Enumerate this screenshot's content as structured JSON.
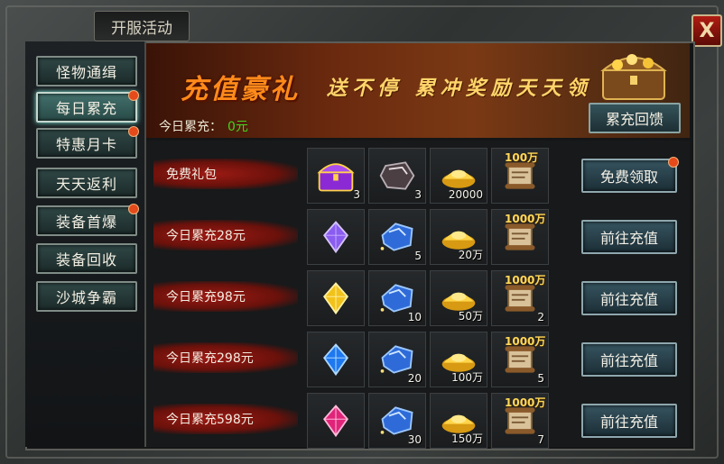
{
  "window": {
    "title": "开服活动",
    "close_label": "X"
  },
  "sidebar": {
    "items": [
      {
        "label": "怪物通缉",
        "active": false,
        "dot": false
      },
      {
        "label": "每日累充",
        "active": true,
        "dot": true
      },
      {
        "label": "特惠月卡",
        "active": false,
        "dot": true
      },
      {
        "label": "天天返利",
        "active": false,
        "dot": false
      },
      {
        "label": "装备首爆",
        "active": false,
        "dot": true
      },
      {
        "label": "装备回收",
        "active": false,
        "dot": false
      },
      {
        "label": "沙城争霸",
        "active": false,
        "dot": false
      }
    ]
  },
  "banner": {
    "title": "充值豪礼",
    "subtitle": "送不停 累冲奖励天天领",
    "today_label": "今日累充：",
    "today_value": "0元",
    "recharge_button": "累充回馈"
  },
  "rows": [
    {
      "label": "免费礼包",
      "button": "免费领取",
      "button_dot": true,
      "items": [
        {
          "icon": "purple-chest-icon",
          "qty": "3",
          "tag": ""
        },
        {
          "icon": "dark-stone-icon",
          "qty": "3",
          "tag": ""
        },
        {
          "icon": "gold-ingot-icon",
          "qty": "20000",
          "tag": ""
        },
        {
          "icon": "scroll-icon",
          "qty": "",
          "tag": "100万"
        }
      ]
    },
    {
      "label": "今日累充28元",
      "button": "前往充值",
      "button_dot": false,
      "items": [
        {
          "icon": "purple-gem-icon",
          "qty": "",
          "tag": ""
        },
        {
          "icon": "blue-crystal-icon",
          "qty": "5",
          "tag": ""
        },
        {
          "icon": "gold-ingot-icon",
          "qty": "20万",
          "tag": ""
        },
        {
          "icon": "scroll-icon",
          "qty": "",
          "tag": "1000万"
        }
      ]
    },
    {
      "label": "今日累充98元",
      "button": "前往充值",
      "button_dot": false,
      "items": [
        {
          "icon": "yellow-gem-icon",
          "qty": "",
          "tag": ""
        },
        {
          "icon": "blue-crystal-icon",
          "qty": "10",
          "tag": ""
        },
        {
          "icon": "gold-ingot-icon",
          "qty": "50万",
          "tag": ""
        },
        {
          "icon": "scroll-icon",
          "qty": "2",
          "tag": "1000万"
        }
      ]
    },
    {
      "label": "今日累充298元",
      "button": "前往充值",
      "button_dot": false,
      "items": [
        {
          "icon": "blue-gem-icon",
          "qty": "",
          "tag": ""
        },
        {
          "icon": "blue-crystal-icon",
          "qty": "20",
          "tag": ""
        },
        {
          "icon": "gold-ingot-icon",
          "qty": "100万",
          "tag": ""
        },
        {
          "icon": "scroll-icon",
          "qty": "5",
          "tag": "1000万"
        }
      ]
    },
    {
      "label": "今日累充598元",
      "button": "前往充值",
      "button_dot": false,
      "items": [
        {
          "icon": "red-gem-icon",
          "qty": "",
          "tag": ""
        },
        {
          "icon": "blue-crystal-icon",
          "qty": "30",
          "tag": ""
        },
        {
          "icon": "gold-ingot-icon",
          "qty": "150万",
          "tag": ""
        },
        {
          "icon": "scroll-icon",
          "qty": "7",
          "tag": "1000万"
        }
      ]
    }
  ]
}
